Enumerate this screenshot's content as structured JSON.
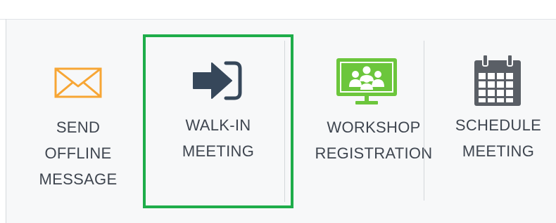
{
  "toolbar": {
    "actions": [
      {
        "id": "send-offline-message",
        "icon": "envelope-icon",
        "icon_color": "#f7a635",
        "lines": [
          "SEND",
          "OFFLINE",
          "MESSAGE"
        ]
      },
      {
        "id": "walk-in-meeting",
        "icon": "sign-in-arrow-icon",
        "icon_color": "#36475a",
        "lines": [
          "WALK-IN",
          "MEETING"
        ],
        "highlighted": true
      },
      {
        "id": "workshop-registration",
        "icon": "group-presentation-monitor-icon",
        "icon_color": "#6cc63c",
        "lines": [
          "WORKSHOP",
          "REGISTRATION"
        ]
      },
      {
        "id": "schedule-meeting",
        "icon": "calendar-icon",
        "icon_color": "#5a5f66",
        "lines": [
          "SCHEDULE",
          "MEETING"
        ]
      }
    ]
  },
  "colors": {
    "highlight_border": "#1ead4a",
    "panel_background": "#f7f8f9",
    "label_text": "#3f4650"
  }
}
